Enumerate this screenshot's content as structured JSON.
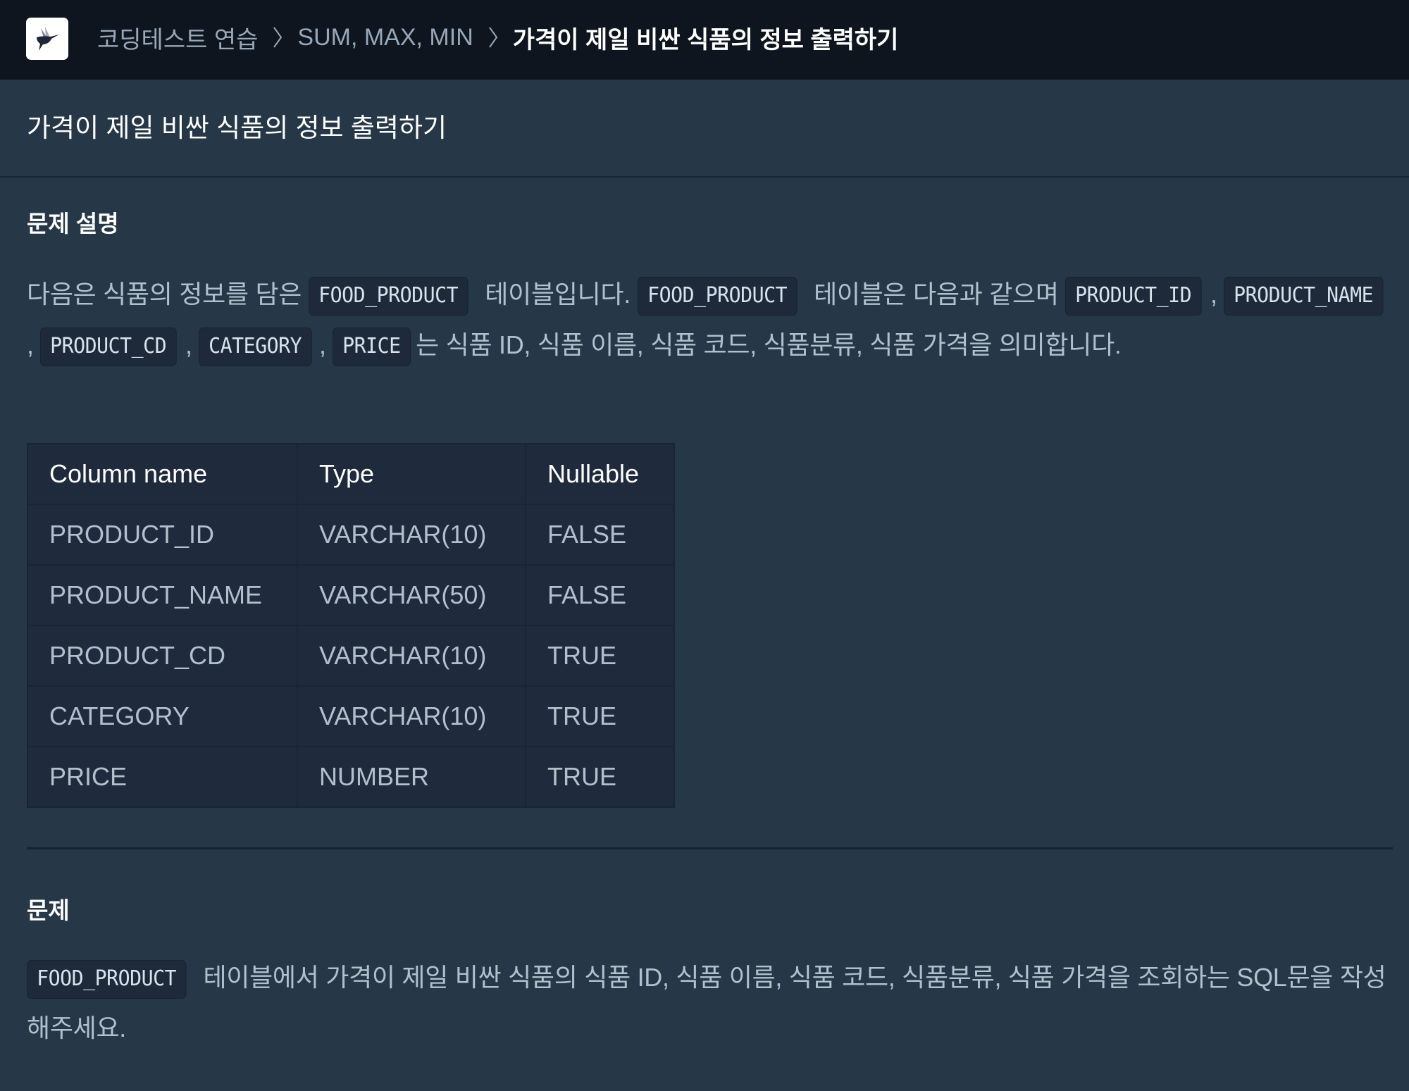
{
  "header": {
    "logo_icon": "hummingbird-logo-icon",
    "breadcrumb": [
      {
        "label": "코딩테스트 연습"
      },
      {
        "label": "SUM, MAX, MIN"
      },
      {
        "label": "가격이 제일 비싼 식품의 정보 출력하기"
      }
    ],
    "separator_icon": "chevron-right-icon"
  },
  "page": {
    "title": "가격이 제일 비싼 식품의 정보 출력하기"
  },
  "description": {
    "heading": "문제 설명",
    "intro_1": "다음은 식품의 정보를 담은",
    "code_table": "FOOD_PRODUCT",
    "intro_2": "테이블입니다.",
    "intro_3": "테이블은 다음과 같으며",
    "code_columns": [
      "PRODUCT_ID",
      "PRODUCT_NAME",
      "PRODUCT_CD",
      "CATEGORY",
      "PRICE"
    ],
    "comma": ",",
    "intro_4": "는 식품 ID, 식품 이름, 식품 코드, 식품분류, 식품 가격을 의미합니다.",
    "table": {
      "headers": [
        "Column name",
        "Type",
        "Nullable"
      ],
      "rows": [
        [
          "PRODUCT_ID",
          "VARCHAR(10)",
          "FALSE"
        ],
        [
          "PRODUCT_NAME",
          "VARCHAR(50)",
          "FALSE"
        ],
        [
          "PRODUCT_CD",
          "VARCHAR(10)",
          "TRUE"
        ],
        [
          "CATEGORY",
          "VARCHAR(10)",
          "TRUE"
        ],
        [
          "PRICE",
          "NUMBER",
          "TRUE"
        ]
      ]
    }
  },
  "problem": {
    "heading": "문제",
    "code_table": "FOOD_PRODUCT",
    "text": "테이블에서 가격이 제일 비싼 식품의 식품 ID, 식품 이름, 식품 코드, 식품분류, 식품 가격을 조회하는 SQL문을 작성해주세요."
  },
  "colors": {
    "header_bg": "#0e151e",
    "page_bg": "#263747",
    "table_bg": "#1f2a3c",
    "code_bg": "#1e2a3a",
    "body_text": "#b2c0cc",
    "breadcrumb_text": "#98a8b9",
    "heading_text": "#ffffff"
  }
}
